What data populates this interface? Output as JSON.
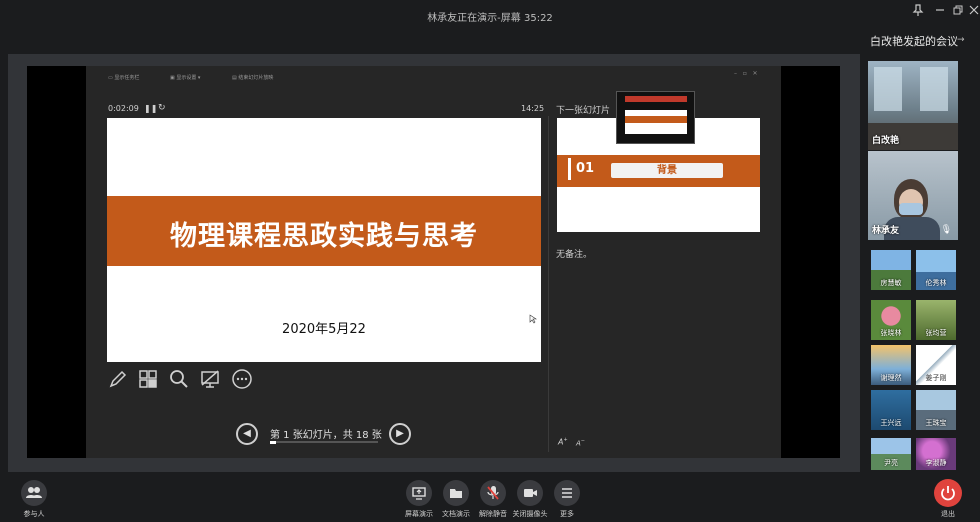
{
  "window": {
    "title": "林承友正在演示-屏幕 35:22",
    "pin_icon": "pin-icon",
    "min_icon": "minimize-icon",
    "restore_icon": "restore-icon",
    "close_icon": "close-icon"
  },
  "presenter": {
    "menu": [
      "显示任务栏",
      "显示设置 ▾",
      "结束幻灯片放映"
    ],
    "elapsed": "0:02:09",
    "clock": "14:25",
    "slide": {
      "title": "物理课程思政实践与思考",
      "date": "2020年5月22"
    },
    "next_label": "下一张幻灯片",
    "next_slide": {
      "number": "01",
      "heading": "背景"
    },
    "notes": "无备注。",
    "nav_text": "第 1 张幻灯片，共 18 张",
    "progress": 0.06,
    "slide_count": 18,
    "current_slide": 1,
    "text_size_buttons": [
      "A",
      "A"
    ]
  },
  "sidebar": {
    "meeting_title": "白改艳发起的会议",
    "featured": [
      {
        "name": "白改艳"
      },
      {
        "name": "林承友"
      }
    ],
    "participants": [
      {
        "name": "房慧敏"
      },
      {
        "name": "伦秀林"
      },
      {
        "name": "张晓林"
      },
      {
        "name": "张均营"
      },
      {
        "name": "谢理然"
      },
      {
        "name": "姜子刚"
      },
      {
        "name": "王兴远"
      },
      {
        "name": "王珠宝"
      },
      {
        "name": "尹亮"
      },
      {
        "name": "李淑静"
      }
    ]
  },
  "bottombar": {
    "participants_label": "参与人",
    "buttons": [
      {
        "label": "屏幕演示",
        "icon": "screen-share-icon"
      },
      {
        "label": "文档演示",
        "icon": "folder-icon"
      },
      {
        "label": "解除静音",
        "icon": "mic-muted-icon"
      },
      {
        "label": "关闭摄像头",
        "icon": "camera-icon"
      },
      {
        "label": "更多",
        "icon": "more-icon"
      }
    ],
    "exit_label": "退出"
  },
  "colors": {
    "accent": "#c35a1a",
    "exit": "#e0433d",
    "mic_muted": "#e0433d"
  }
}
